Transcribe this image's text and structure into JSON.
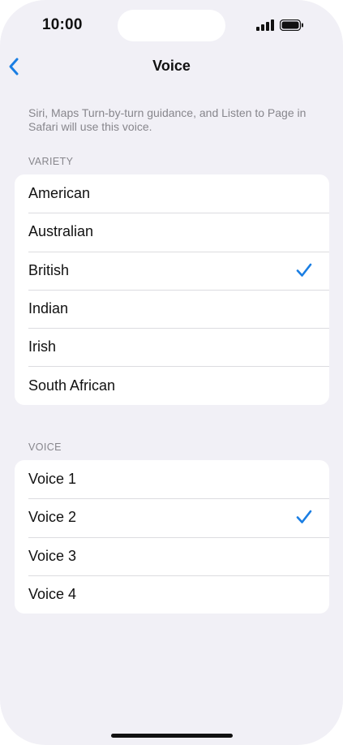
{
  "status_bar": {
    "time": "10:00"
  },
  "nav": {
    "title": "Voice",
    "back_icon": "chevron-left-icon"
  },
  "description": "Siri, Maps Turn-by-turn guidance, and Listen to Page in Safari will use this voice.",
  "variety_section": {
    "header": "VARIETY",
    "options": [
      {
        "label": "American",
        "selected": false
      },
      {
        "label": "Australian",
        "selected": false
      },
      {
        "label": "British",
        "selected": true
      },
      {
        "label": "Indian",
        "selected": false
      },
      {
        "label": "Irish",
        "selected": false
      },
      {
        "label": "South African",
        "selected": false
      }
    ]
  },
  "voice_section": {
    "header": "VOICE",
    "options": [
      {
        "label": "Voice 1",
        "selected": false
      },
      {
        "label": "Voice 2",
        "selected": true
      },
      {
        "label": "Voice 3",
        "selected": false
      },
      {
        "label": "Voice 4",
        "selected": false
      }
    ]
  },
  "colors": {
    "accent": "#1a7ee3",
    "background": "#f1f0f6",
    "secondary_text": "#87868c"
  }
}
